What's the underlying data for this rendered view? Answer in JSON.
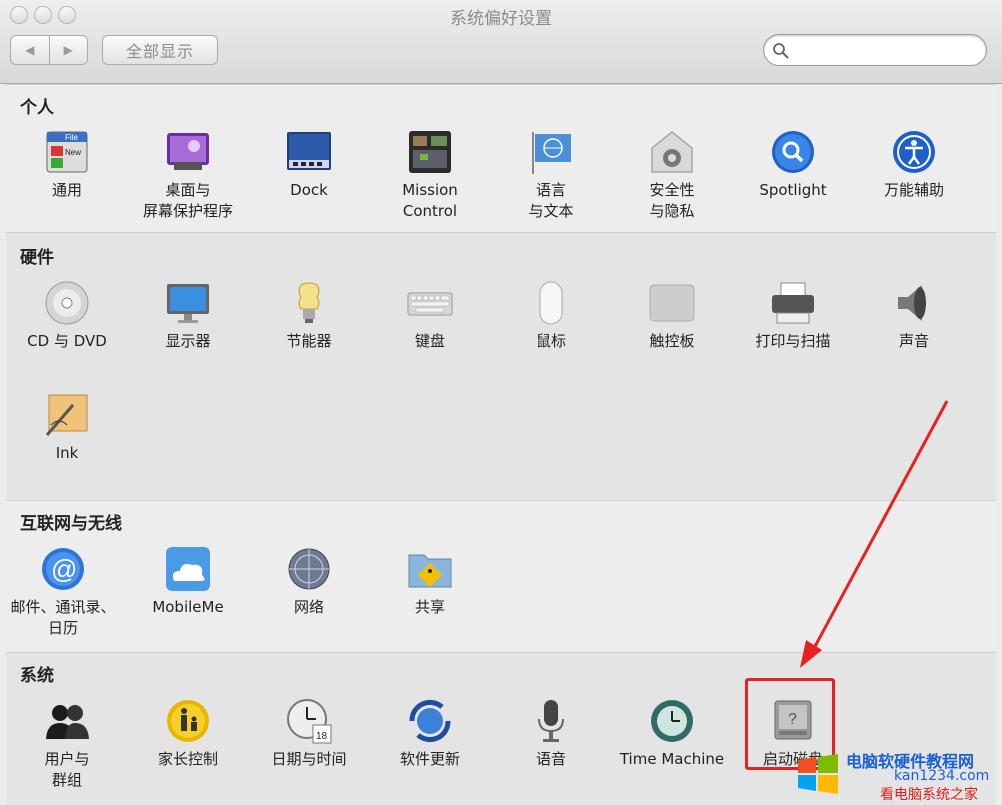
{
  "window": {
    "title": "系统偏好设置",
    "show_all": "全部显示",
    "search_placeholder": ""
  },
  "sections": [
    {
      "title": "个人",
      "items": [
        {
          "label": "通用",
          "icon": "general-icon"
        },
        {
          "label": "桌面与\n屏幕保护程序",
          "icon": "desktop-icon"
        },
        {
          "label": "Dock",
          "icon": "dock-icon"
        },
        {
          "label": "Mission\nControl",
          "icon": "mission-control-icon"
        },
        {
          "label": "语言\n与文本",
          "icon": "language-icon"
        },
        {
          "label": "安全性\n与隐私",
          "icon": "security-icon"
        },
        {
          "label": "Spotlight",
          "icon": "spotlight-icon"
        },
        {
          "label": "万能辅助",
          "icon": "accessibility-icon"
        }
      ]
    },
    {
      "title": "硬件",
      "items": [
        {
          "label": "CD 与 DVD",
          "icon": "cd-icon"
        },
        {
          "label": "显示器",
          "icon": "display-icon"
        },
        {
          "label": "节能器",
          "icon": "energy-icon"
        },
        {
          "label": "键盘",
          "icon": "keyboard-icon"
        },
        {
          "label": "鼠标",
          "icon": "mouse-icon"
        },
        {
          "label": "触控板",
          "icon": "trackpad-icon"
        },
        {
          "label": "打印与扫描",
          "icon": "printer-icon"
        },
        {
          "label": "声音",
          "icon": "sound-icon"
        },
        {
          "label": "Ink",
          "icon": "ink-icon"
        }
      ]
    },
    {
      "title": "互联网与无线",
      "items": [
        {
          "label": "邮件、通讯录、\n日历",
          "icon": "mail-icon"
        },
        {
          "label": "MobileMe",
          "icon": "mobileme-icon"
        },
        {
          "label": "网络",
          "icon": "network-icon"
        },
        {
          "label": "共享",
          "icon": "sharing-icon"
        }
      ]
    },
    {
      "title": "系统",
      "items": [
        {
          "label": "用户与\n群组",
          "icon": "users-icon"
        },
        {
          "label": "家长控制",
          "icon": "parental-icon"
        },
        {
          "label": "日期与时间",
          "icon": "clock-icon"
        },
        {
          "label": "软件更新",
          "icon": "update-icon"
        },
        {
          "label": "语音",
          "icon": "microphone-icon"
        },
        {
          "label": "Time Machine",
          "icon": "time-machine-icon"
        },
        {
          "label": "启动磁盘",
          "icon": "startup-disk-icon"
        }
      ]
    }
  ],
  "watermark": {
    "line1": "电脑软硬件教程网",
    "line2": "kan1234.com",
    "line3": "看电脑系统之家"
  },
  "colors": {
    "highlight": "#e8201f",
    "watermark_blue": "#1a5fd6"
  }
}
